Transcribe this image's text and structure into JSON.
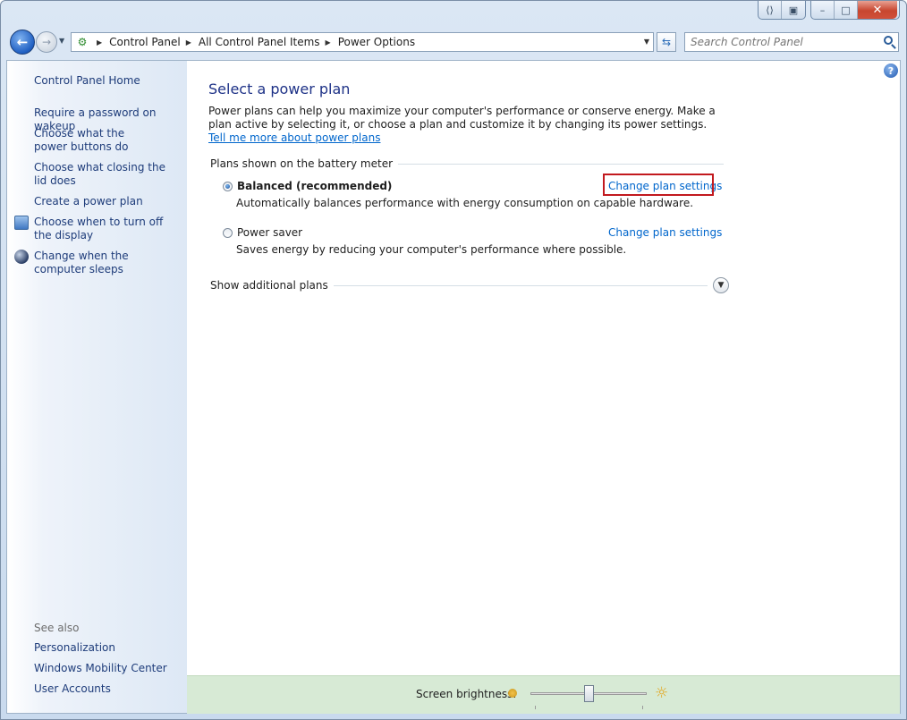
{
  "titlebar": {
    "caption_buttons": {
      "restore_left": "⟨⟩",
      "pin": "▣",
      "minimize": "–",
      "maximize": "□",
      "close": "✕"
    }
  },
  "navbar": {
    "breadcrumbs": [
      "Control Panel",
      "All Control Panel Items",
      "Power Options"
    ],
    "search_placeholder": "Search Control Panel"
  },
  "sidebar": {
    "home": "Control Panel Home",
    "tasks": [
      "Require a password on wakeup",
      "Choose what the power buttons do",
      "Choose what closing the lid does",
      "Create a power plan",
      "Choose when to turn off the display",
      "Change when the computer sleeps"
    ],
    "see_also_label": "See also",
    "see_also": [
      "Personalization",
      "Windows Mobility Center",
      "User Accounts"
    ]
  },
  "main": {
    "title": "Select a power plan",
    "intro": "Power plans can help you maximize your computer's performance or conserve energy. Make a plan active by selecting it, or choose a plan and customize it by changing its power settings.",
    "intro_link": "Tell me more about power plans",
    "group_label": "Plans shown on the battery meter",
    "plans": [
      {
        "name": "Balanced (recommended)",
        "description": "Automatically balances performance with energy consumption on capable hardware.",
        "link": "Change plan settings",
        "selected": true
      },
      {
        "name": "Power saver",
        "description": "Saves energy by reducing your computer's performance where possible.",
        "link": "Change plan settings",
        "selected": false
      }
    ],
    "more_plans": "Show additional plans"
  },
  "footer": {
    "brightness_label": "Screen brightness:",
    "brightness_level": 0.5
  },
  "colors": {
    "link": "#0066cc",
    "title": "#1e3287",
    "highlight": "#c2191e",
    "footer_bg": "#d7ead5"
  }
}
